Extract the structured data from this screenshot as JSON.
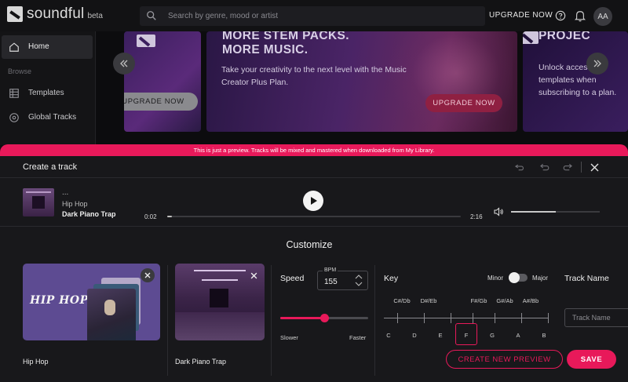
{
  "app": {
    "logo_text": "soundful",
    "logo_badge": "beta",
    "search_placeholder": "Search by genre, mood or artist",
    "upgrade_label": "UPGRADE NOW",
    "avatar_initials": "AA"
  },
  "sidebar": {
    "items": [
      {
        "label": "Home",
        "icon": "home-icon",
        "active": true
      },
      {
        "label": "Templates",
        "icon": "table-icon",
        "active": false
      },
      {
        "label": "Global Tracks",
        "icon": "disc-icon",
        "active": false
      }
    ],
    "section_label": "Browse"
  },
  "carousel": {
    "left_card": {
      "button": "UPGRADE NOW"
    },
    "main_card": {
      "title_line1": "MORE STEM PACKS.",
      "title_line2": "MORE MUSIC.",
      "description": "Take your creativity to the next level with the Music Creator Plus Plan.",
      "button": "UPGRADE NOW"
    },
    "right_card": {
      "title": "PROJEC",
      "description": "Unlock access to templates when subscribing to a plan."
    }
  },
  "banner": {
    "text": "This is just a preview. Tracks will be mixed and mastered when downloaded from My Library."
  },
  "panel": {
    "title": "Create a track"
  },
  "player": {
    "dots": "...",
    "genre": "Hip Hop",
    "track_name": "Dark Piano Trap",
    "time_current": "0:02",
    "time_total": "2:16",
    "progress_fraction": 0.015,
    "volume_fraction": 0.5
  },
  "customize": {
    "title": "Customize",
    "tiles": [
      {
        "label": "Hip Hop",
        "art_text": "HIP HOP"
      },
      {
        "label": "Dark Piano Trap"
      }
    ],
    "speed": {
      "title": "Speed",
      "bpm_label": "BPM",
      "bpm_value": "155",
      "slider_fraction": 0.5,
      "min_label": "Slower",
      "max_label": "Faster"
    },
    "key": {
      "title": "Key",
      "minor_label": "Minor",
      "major_label": "Major",
      "sharps": [
        "C#/Db",
        "D#/Eb",
        "F#/Gb",
        "G#/Ab",
        "A#/Bb"
      ],
      "naturals": [
        "C",
        "D",
        "E",
        "F",
        "G",
        "A",
        "B"
      ],
      "selected": "F"
    },
    "track_name": {
      "title": "Track Name",
      "placeholder": "Track Name"
    },
    "buttons": {
      "preview": "CREATE NEW PREVIEW",
      "save": "SAVE"
    }
  },
  "colors": {
    "accent": "#e8195a",
    "background": "#18181b"
  }
}
